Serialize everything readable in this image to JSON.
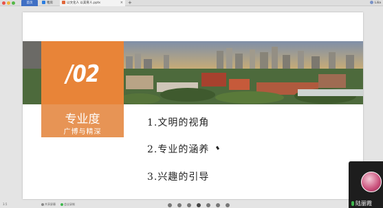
{
  "tabs": {
    "home": "首页",
    "second": "租房",
    "document": "以文化人 以美育人.pptx",
    "new_tab": "+",
    "close": "×"
  },
  "user": {
    "name": "Lilia"
  },
  "slide": {
    "section_number": "/02",
    "section_title": "专业度",
    "section_subtitle": "广博与精深",
    "items": [
      "1.文明的视角",
      "2.专业的涵养",
      "3.兴趣的引导"
    ]
  },
  "video": {
    "participant_name": "陆丽霞"
  },
  "bottom": {
    "left_status": "3.5",
    "share_label": "共享屏幕",
    "record_label": "会议录制",
    "page_count": 7,
    "current_page": 4
  },
  "colors": {
    "accent_orange": "#e88438",
    "tab_blue": "#3f6fc4",
    "mic_green": "#3fb84e"
  }
}
